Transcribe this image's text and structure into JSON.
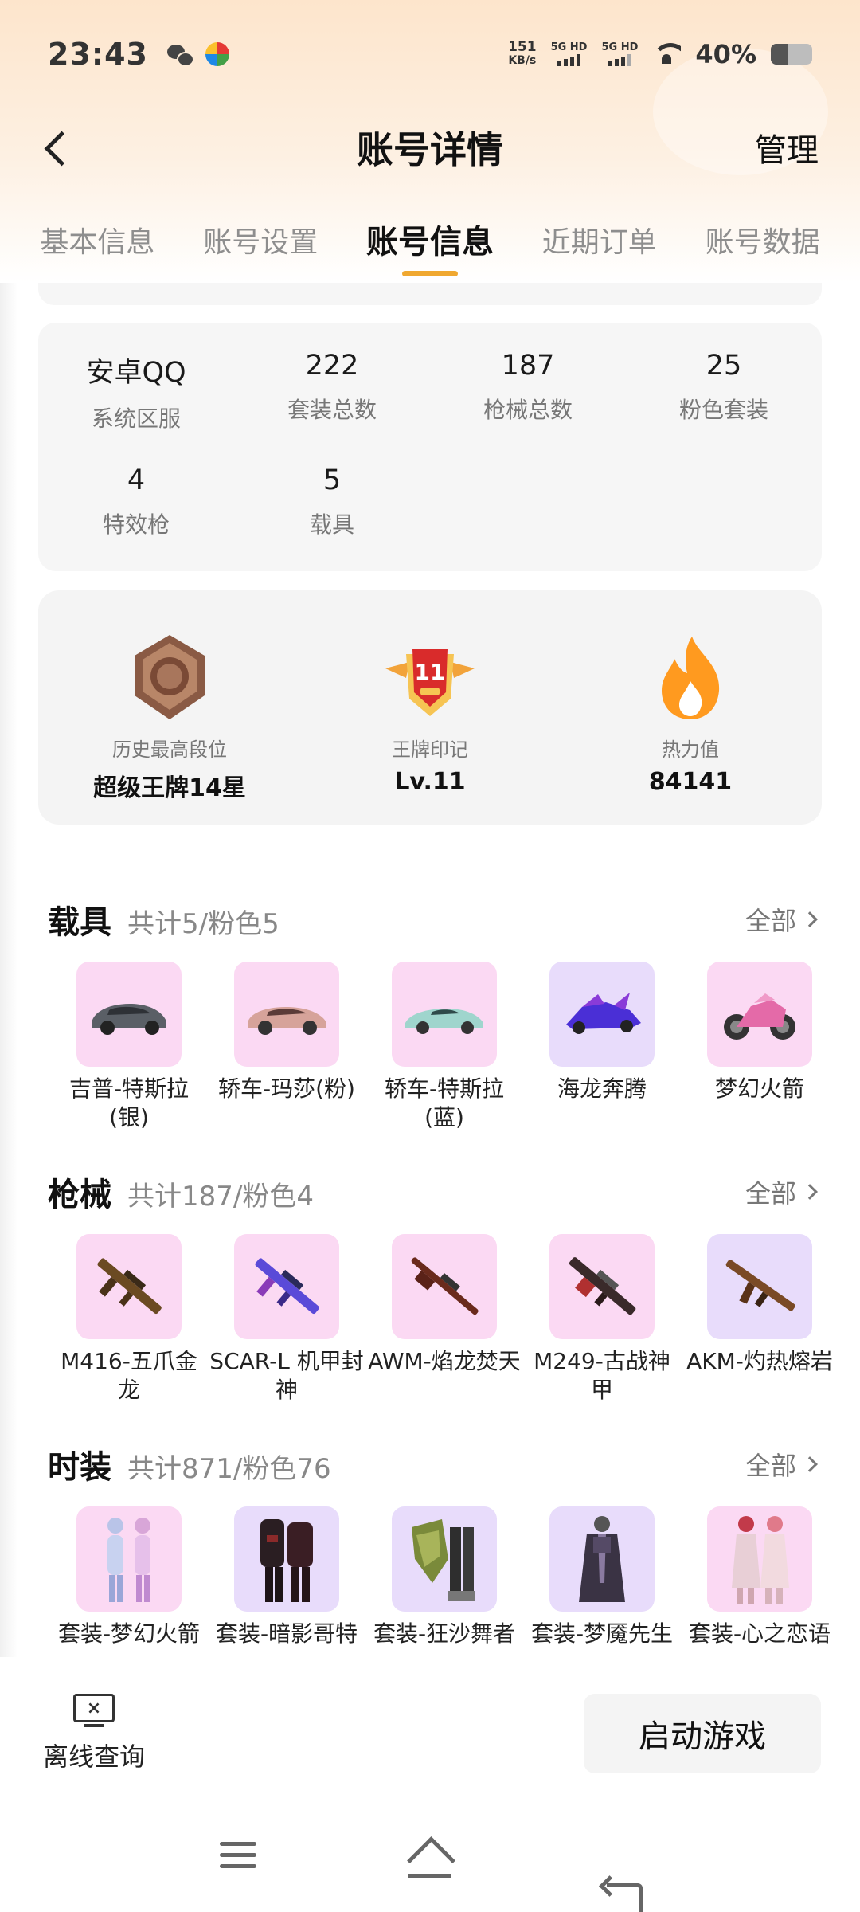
{
  "status_bar": {
    "time": "23:43",
    "speed_value": "151",
    "speed_unit": "KB/s",
    "sim1": "5G HD",
    "sim2": "5G HD",
    "battery": "40%",
    "battery_level": 0.4
  },
  "nav": {
    "title": "账号详情",
    "manage": "管理"
  },
  "tabs": [
    {
      "label": "基本信息",
      "active": false
    },
    {
      "label": "账号设置",
      "active": false
    },
    {
      "label": "账号信息",
      "active": true
    },
    {
      "label": "近期订单",
      "active": false
    },
    {
      "label": "账号数据",
      "active": false
    }
  ],
  "stats": [
    {
      "value": "安卓QQ",
      "label": "系统区服"
    },
    {
      "value": "222",
      "label": "套装总数"
    },
    {
      "value": "187",
      "label": "枪械总数"
    },
    {
      "value": "25",
      "label": "粉色套装"
    },
    {
      "value": "4",
      "label": "特效枪"
    },
    {
      "value": "5",
      "label": "载具"
    }
  ],
  "ranks": [
    {
      "label": "历史最高段位",
      "value": "超级王牌14星"
    },
    {
      "label": "王牌印记",
      "value": "Lv.11",
      "badge_number": "11"
    },
    {
      "label": "热力值",
      "value": "84141"
    }
  ],
  "sections": {
    "vehicles": {
      "title": "载具",
      "count": "共计5/粉色5",
      "all": "全部",
      "items": [
        {
          "name": "吉普-特斯拉(银)",
          "icon": "silver-car"
        },
        {
          "name": "轿车-玛莎(粉)",
          "icon": "pink-car"
        },
        {
          "name": "轿车-特斯拉(蓝)",
          "icon": "blue-car"
        },
        {
          "name": "海龙奔腾",
          "icon": "race-car"
        },
        {
          "name": "梦幻火箭",
          "icon": "motorbike"
        }
      ]
    },
    "guns": {
      "title": "枪械",
      "count": "共计187/粉色4",
      "all": "全部",
      "items": [
        {
          "name": "M416-五爪金龙",
          "icon": "rifle"
        },
        {
          "name": "SCAR-L 机甲封神",
          "icon": "rifle-blue"
        },
        {
          "name": "AWM-焰龙焚天",
          "icon": "sniper"
        },
        {
          "name": "M249-古战神甲",
          "icon": "lmg"
        },
        {
          "name": "AKM-灼热熔岩",
          "icon": "ak"
        }
      ]
    },
    "outfits": {
      "title": "时装",
      "count": "共计871/粉色76",
      "all": "全部",
      "items": [
        {
          "name": "套装-梦幻火箭",
          "icon": "outfit-white"
        },
        {
          "name": "套装-暗影哥特",
          "icon": "outfit-dark"
        },
        {
          "name": "套装-狂沙舞者",
          "icon": "outfit-green"
        },
        {
          "name": "套装-梦魇先生",
          "icon": "outfit-coat"
        },
        {
          "name": "套装-心之恋语",
          "icon": "outfit-pink"
        }
      ]
    }
  },
  "bottom": {
    "offline_label": "离线查询",
    "launch_label": "启动游戏"
  },
  "colors": {
    "accent": "#f0a830",
    "thumb_pink": "#fbd9f3",
    "thumb_purple": "#e8dcfb"
  }
}
